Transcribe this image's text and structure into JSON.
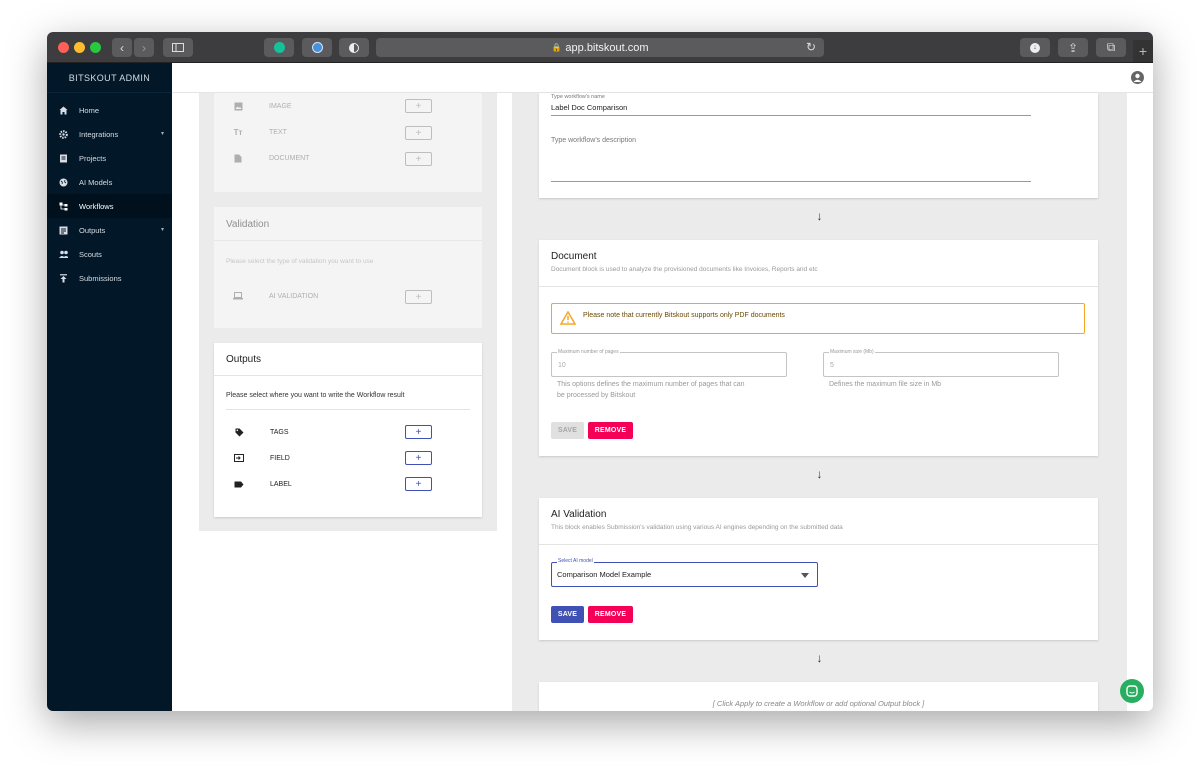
{
  "browser": {
    "url": "app.bitskout.com"
  },
  "sidebar": {
    "title": "BITSKOUT ADMIN",
    "items": [
      {
        "label": "Home",
        "icon": "home-icon"
      },
      {
        "label": "Integrations",
        "icon": "gear-icon",
        "expandable": true
      },
      {
        "label": "Projects",
        "icon": "clipboard-icon"
      },
      {
        "label": "AI Models",
        "icon": "globe-icon"
      },
      {
        "label": "Workflows",
        "icon": "workflow-icon",
        "active": true
      },
      {
        "label": "Outputs",
        "icon": "list-icon",
        "expandable": true
      },
      {
        "label": "Scouts",
        "icon": "people-icon"
      },
      {
        "label": "Submissions",
        "icon": "upload-icon"
      }
    ]
  },
  "inputs_card": {
    "items": [
      {
        "label": "IMAGE"
      },
      {
        "label": "TEXT"
      },
      {
        "label": "DOCUMENT"
      }
    ],
    "add_symbol": "+"
  },
  "validation_card": {
    "title": "Validation",
    "subtitle": "Please select the type of validation you want to use",
    "items": [
      {
        "label": "AI VALIDATION"
      }
    ]
  },
  "outputs_card": {
    "title": "Outputs",
    "subtitle": "Please select where you want to write the Workflow result",
    "items": [
      {
        "label": "TAGS"
      },
      {
        "label": "FIELD"
      },
      {
        "label": "LABEL"
      }
    ]
  },
  "workflow_card": {
    "name_label": "Type workflow's name",
    "name_value": "Label Doc Comparison",
    "description_placeholder": "Type workflow's description"
  },
  "document_card": {
    "title": "Document",
    "subtitle": "Document block is used to analyze the provisioned documents like Invoices, Reports and etc",
    "warning": "Please note that currently Bitskout supports only PDF documents",
    "max_pages_label": "Maximum number of pages",
    "max_pages_value": "10",
    "max_pages_help_1": "This options defines the maximum number of pages that can",
    "max_pages_help_2": "be processed by Bitskout",
    "max_size_label": "Maximum size (Mb)",
    "max_size_value": "5",
    "max_size_help": "Defines the maximum file size in Mb",
    "save_label": "SAVE",
    "remove_label": "REMOVE"
  },
  "ai_validation_card": {
    "title": "AI Validation",
    "subtitle": "This block enables Submission's validation using various AI engines depending on the submitted data",
    "select_label": "Select AI model",
    "select_value": "Comparison Model Example",
    "save_label": "SAVE",
    "remove_label": "REMOVE"
  },
  "final_card": {
    "hint": "[ Click Apply to create a Workflow or add optional Output block ]"
  },
  "flow_arrow": "↓",
  "colors": {
    "sidebar_bg": "#021728",
    "primary": "#3f51b5",
    "danger": "#f50057",
    "warning_border": "#f5a623",
    "chat": "#27ae60"
  }
}
